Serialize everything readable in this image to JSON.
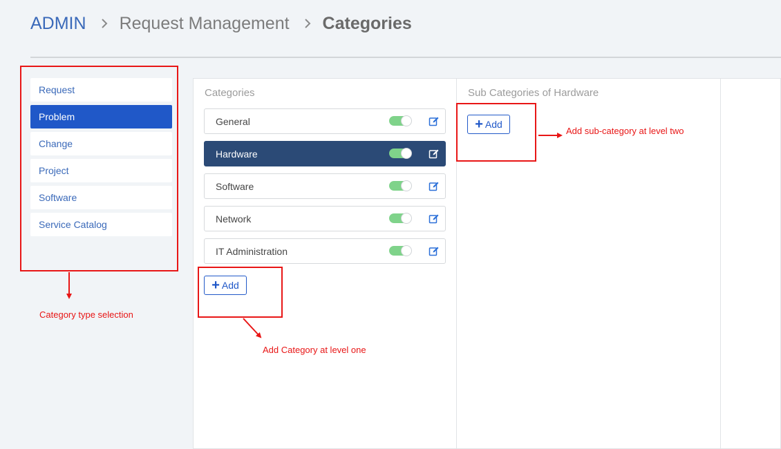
{
  "breadcrumb": {
    "root": "ADMIN",
    "section": "Request Management",
    "current": "Categories"
  },
  "category_types": [
    {
      "label": "Request",
      "active": false
    },
    {
      "label": "Problem",
      "active": true
    },
    {
      "label": "Change",
      "active": false
    },
    {
      "label": "Project",
      "active": false
    },
    {
      "label": "Software",
      "active": false
    },
    {
      "label": "Service Catalog",
      "active": false
    }
  ],
  "categories_panel": {
    "title": "Categories",
    "items": [
      {
        "label": "General",
        "enabled": true,
        "selected": false
      },
      {
        "label": "Hardware",
        "enabled": true,
        "selected": true
      },
      {
        "label": "Software",
        "enabled": true,
        "selected": false
      },
      {
        "label": "Network",
        "enabled": true,
        "selected": false
      },
      {
        "label": "IT Administration",
        "enabled": true,
        "selected": false
      }
    ],
    "add_label": "Add"
  },
  "subcategories_panel": {
    "title": "Sub Categories of Hardware",
    "add_label": "Add"
  },
  "annotations": {
    "type_selection": "Category type selection",
    "add_level_one": "Add Category at level one",
    "add_level_two": "Add sub-category at level two"
  },
  "colors": {
    "accent": "#2058c8",
    "selected_row": "#2b4a76",
    "toggle_on": "#7fd38a",
    "annotation": "#e81515"
  }
}
